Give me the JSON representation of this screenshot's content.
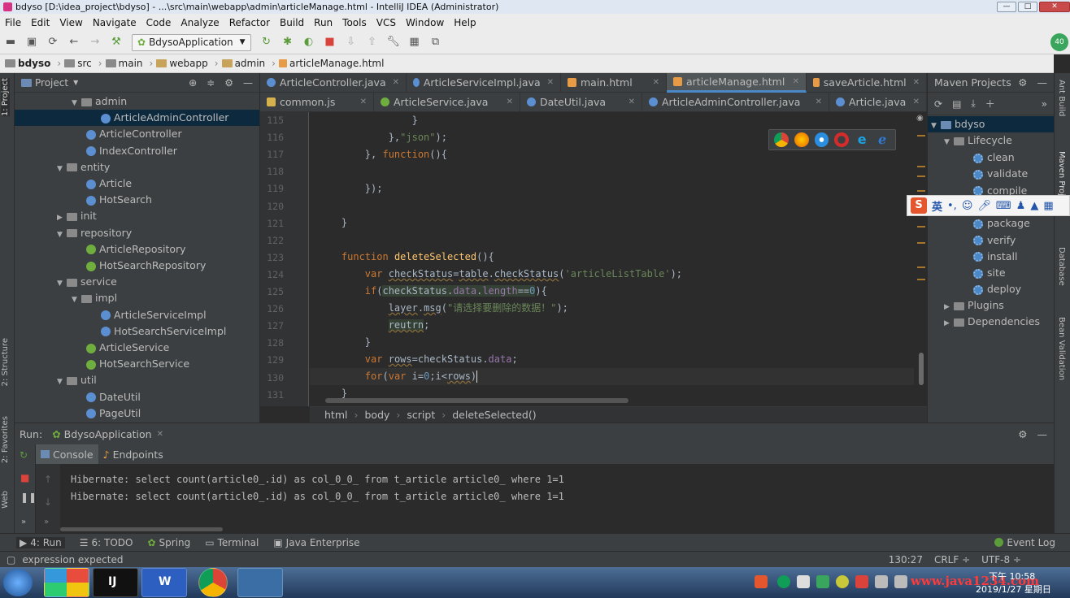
{
  "window": {
    "title": "bdyso [D:\\idea_project\\bdyso] - ...\\src\\main\\webapp\\admin\\articleManage.html - IntelliJ IDEA (Administrator)"
  },
  "menu": [
    "File",
    "Edit",
    "View",
    "Navigate",
    "Code",
    "Analyze",
    "Refactor",
    "Build",
    "Run",
    "Tools",
    "VCS",
    "Window",
    "Help"
  ],
  "toolbar": {
    "run_config": "BdysoApplication"
  },
  "breadcrumbs": [
    "bdyso",
    "src",
    "main",
    "webapp",
    "admin",
    "articleManage.html"
  ],
  "left_strip": {
    "project": "1: Project",
    "structure": "2: Structure",
    "favorites": "2: Favorites",
    "web": "Web"
  },
  "project": {
    "title": "Project",
    "items": [
      {
        "label": "admin",
        "kind": "folder",
        "open": true,
        "indent": 3
      },
      {
        "label": "ArticleAdminController",
        "kind": "class",
        "indent": 4,
        "selected": true
      },
      {
        "label": "ArticleController",
        "kind": "class",
        "indent": 3
      },
      {
        "label": "IndexController",
        "kind": "class",
        "indent": 3
      },
      {
        "label": "entity",
        "kind": "folder",
        "open": true,
        "indent": 2
      },
      {
        "label": "Article",
        "kind": "class",
        "indent": 3
      },
      {
        "label": "HotSearch",
        "kind": "class",
        "indent": 3
      },
      {
        "label": "init",
        "kind": "folder",
        "open": false,
        "indent": 2
      },
      {
        "label": "repository",
        "kind": "folder",
        "open": true,
        "indent": 2
      },
      {
        "label": "ArticleRepository",
        "kind": "iface",
        "indent": 3
      },
      {
        "label": "HotSearchRepository",
        "kind": "iface",
        "indent": 3
      },
      {
        "label": "service",
        "kind": "folder",
        "open": true,
        "indent": 2
      },
      {
        "label": "impl",
        "kind": "folder",
        "open": true,
        "indent": 3
      },
      {
        "label": "ArticleServiceImpl",
        "kind": "class",
        "indent": 4
      },
      {
        "label": "HotSearchServiceImpl",
        "kind": "class",
        "indent": 4
      },
      {
        "label": "ArticleService",
        "kind": "iface",
        "indent": 3
      },
      {
        "label": "HotSearchService",
        "kind": "iface",
        "indent": 3
      },
      {
        "label": "util",
        "kind": "folder",
        "open": true,
        "indent": 2
      },
      {
        "label": "DateUtil",
        "kind": "class",
        "indent": 3
      },
      {
        "label": "PageUtil",
        "kind": "class",
        "indent": 3
      }
    ]
  },
  "tabs_row1": [
    {
      "label": "ArticleController.java",
      "type": "c"
    },
    {
      "label": "ArticleServiceImpl.java",
      "type": "c"
    },
    {
      "label": "main.html",
      "type": "h"
    },
    {
      "label": "articleManage.html",
      "type": "h",
      "active": true
    },
    {
      "label": "saveArticle.html",
      "type": "h"
    }
  ],
  "tabs_row2": [
    {
      "label": "common.js",
      "type": "j"
    },
    {
      "label": "ArticleService.java",
      "type": "i"
    },
    {
      "label": "DateUtil.java",
      "type": "c"
    },
    {
      "label": "ArticleAdminController.java",
      "type": "c"
    },
    {
      "label": "Article.java",
      "type": "c"
    }
  ],
  "editor": {
    "line_numbers": [
      "115",
      "116",
      "117",
      "118",
      "119",
      "120",
      "121",
      "122",
      "123",
      "124",
      "125",
      "126",
      "127",
      "128",
      "129",
      "130",
      "131"
    ]
  },
  "code_breadcrumb": [
    "html",
    "body",
    "script",
    "deleteSelected()"
  ],
  "maven": {
    "title": "Maven Projects",
    "root": "bdyso",
    "lifecycle": "Lifecycle",
    "goals": [
      "clean",
      "validate",
      "compile",
      "package",
      "verify",
      "install",
      "site",
      "deploy"
    ],
    "plugins": "Plugins",
    "dependencies": "Dependencies"
  },
  "right_strip": {
    "ant": "Ant Build",
    "maven": "Maven Projects",
    "database": "Database",
    "bean": "Bean Validation"
  },
  "ime": {
    "lang": "英"
  },
  "run": {
    "label": "Run:",
    "config": "BdysoApplication",
    "tabs": [
      "Console",
      "Endpoints"
    ],
    "lines": [
      "Hibernate: select count(article0_.id) as col_0_0_ from t_article article0_ where 1=1",
      "Hibernate: select count(article0_.id) as col_0_0_ from t_article article0_ where 1=1"
    ]
  },
  "tool_windows": [
    "4: Run",
    "6: TODO",
    "Spring",
    "Terminal",
    "Java Enterprise"
  ],
  "event_log": "Event Log",
  "status": {
    "message": "expression expected",
    "position": "130:27",
    "line_sep": "CRLF ÷",
    "encoding": "UTF-8 ÷"
  },
  "taskbar": {
    "time": "下午 10:58",
    "date": "2019/1/27 星期日",
    "watermark": "www.java1234.com"
  },
  "colors": {
    "accent": "#4a88c7",
    "selection": "#0d293e",
    "keyword": "#cc7832",
    "function": "#ffc66d",
    "string": "#6a8759",
    "number": "#6897bb"
  }
}
